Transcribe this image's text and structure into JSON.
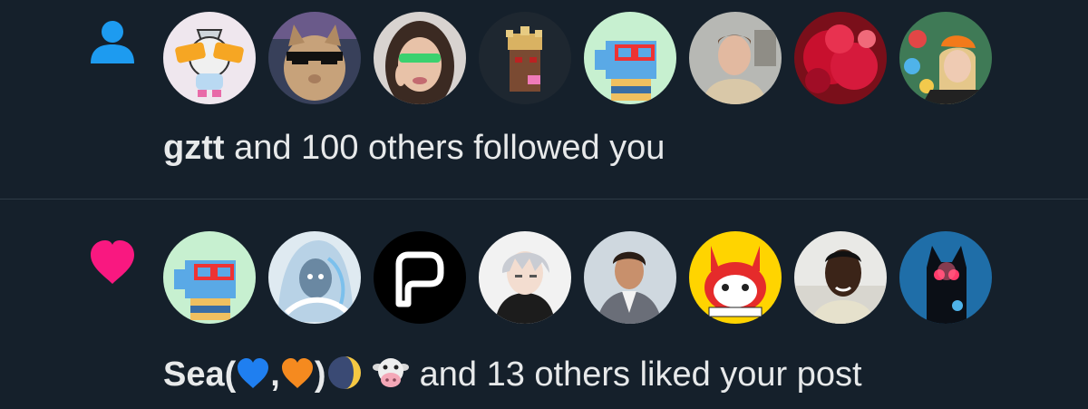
{
  "notifications": [
    {
      "type": "follow",
      "icon": "person-icon",
      "icon_color": "#1d9bf0",
      "actor_name": "gztt",
      "rest_text": "and 100 others followed you",
      "avatars": [
        "seeing-signs-avatar",
        "cat-sunglasses-avatar",
        "woman-green-glasses-avatar",
        "pixel-punk-avatar",
        "pixel-blue-fish-avatar",
        "man-portrait-avatar",
        "red-feathers-avatar",
        "woman-orange-cap-avatar"
      ]
    },
    {
      "type": "like",
      "icon": "heart-icon",
      "icon_color": "#f91880",
      "actor_name_prefix": "Sea(",
      "actor_name_sep": ",",
      "actor_name_suffix": ")",
      "emojis": [
        "blue-heart-emoji",
        "orange-heart-emoji",
        "moon-emoji",
        "cow-emoji"
      ],
      "rest_text": "and 13 others liked your post",
      "avatars": [
        "pixel-blue-fish-avatar",
        "anime-girl-avatar",
        "logo-p-avatar",
        "anime-boy-avatar",
        "man-suit-avatar",
        "red-bunny-avatar",
        "man-smiling-avatar",
        "dark-creature-avatar"
      ]
    }
  ]
}
